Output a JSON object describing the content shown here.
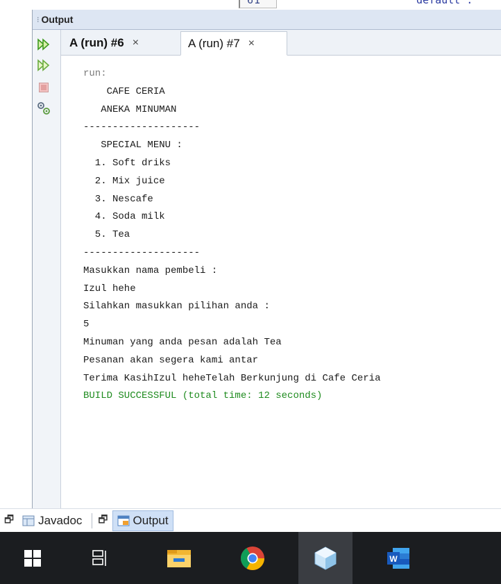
{
  "editor_fragment": {
    "line_number": "61",
    "code_text": "default :"
  },
  "output_window": {
    "title": "Output",
    "tabs": [
      {
        "label": "A (run) #6",
        "close": "×",
        "active": false
      },
      {
        "label": "A (run) #7",
        "close": "×",
        "active": true
      }
    ],
    "toolbar_icons": [
      "rerun-icon",
      "rerun-with-options-icon",
      "stop-icon",
      "settings-icon"
    ],
    "console": {
      "lines": [
        {
          "text": "run:",
          "style": "meta"
        },
        {
          "text": "    CAFE CERIA",
          "style": "normal"
        },
        {
          "text": "   ANEKA MINUMAN",
          "style": "normal"
        },
        {
          "text": "--------------------",
          "style": "normal"
        },
        {
          "text": "   SPECIAL MENU :",
          "style": "normal"
        },
        {
          "text": "  1. Soft driks",
          "style": "normal"
        },
        {
          "text": "  2. Mix juice",
          "style": "normal"
        },
        {
          "text": "  3. Nescafe",
          "style": "normal"
        },
        {
          "text": "  4. Soda milk",
          "style": "normal"
        },
        {
          "text": "  5. Tea",
          "style": "normal"
        },
        {
          "text": "--------------------",
          "style": "normal"
        },
        {
          "text": "Masukkan nama pembeli :",
          "style": "normal"
        },
        {
          "text": "Izul hehe",
          "style": "normal"
        },
        {
          "text": "Silahkan masukkan pilihan anda :",
          "style": "normal"
        },
        {
          "text": "5",
          "style": "normal"
        },
        {
          "text": "Minuman yang anda pesan adalah Tea",
          "style": "normal"
        },
        {
          "text": "Pesanan akan segera kami antar",
          "style": "normal"
        },
        {
          "text": "Terima KasihIzul heheTelah Berkunjung di Cafe Ceria",
          "style": "normal"
        },
        {
          "text": "BUILD SUCCESSFUL (total time: 12 seconds)",
          "style": "ok"
        }
      ]
    }
  },
  "dock": {
    "items": [
      {
        "label": "Javadoc",
        "icon": "javadoc-icon",
        "active": false
      },
      {
        "label": "Output",
        "icon": "output-icon",
        "active": true
      }
    ]
  },
  "taskbar": {
    "items": [
      {
        "icon": "windows-start-icon",
        "active": false
      },
      {
        "icon": "task-view-icon",
        "active": false
      },
      {
        "icon": "file-explorer-icon",
        "active": false
      },
      {
        "icon": "chrome-icon",
        "active": false
      },
      {
        "icon": "netbeans-icon",
        "active": true
      },
      {
        "icon": "word-icon",
        "active": false
      }
    ]
  },
  "colors": {
    "build_success": "#1e8b1e",
    "header_bg": "#dde6f3",
    "taskbar_bg": "#1b1d20",
    "dock_active": "#cfe0f6"
  }
}
